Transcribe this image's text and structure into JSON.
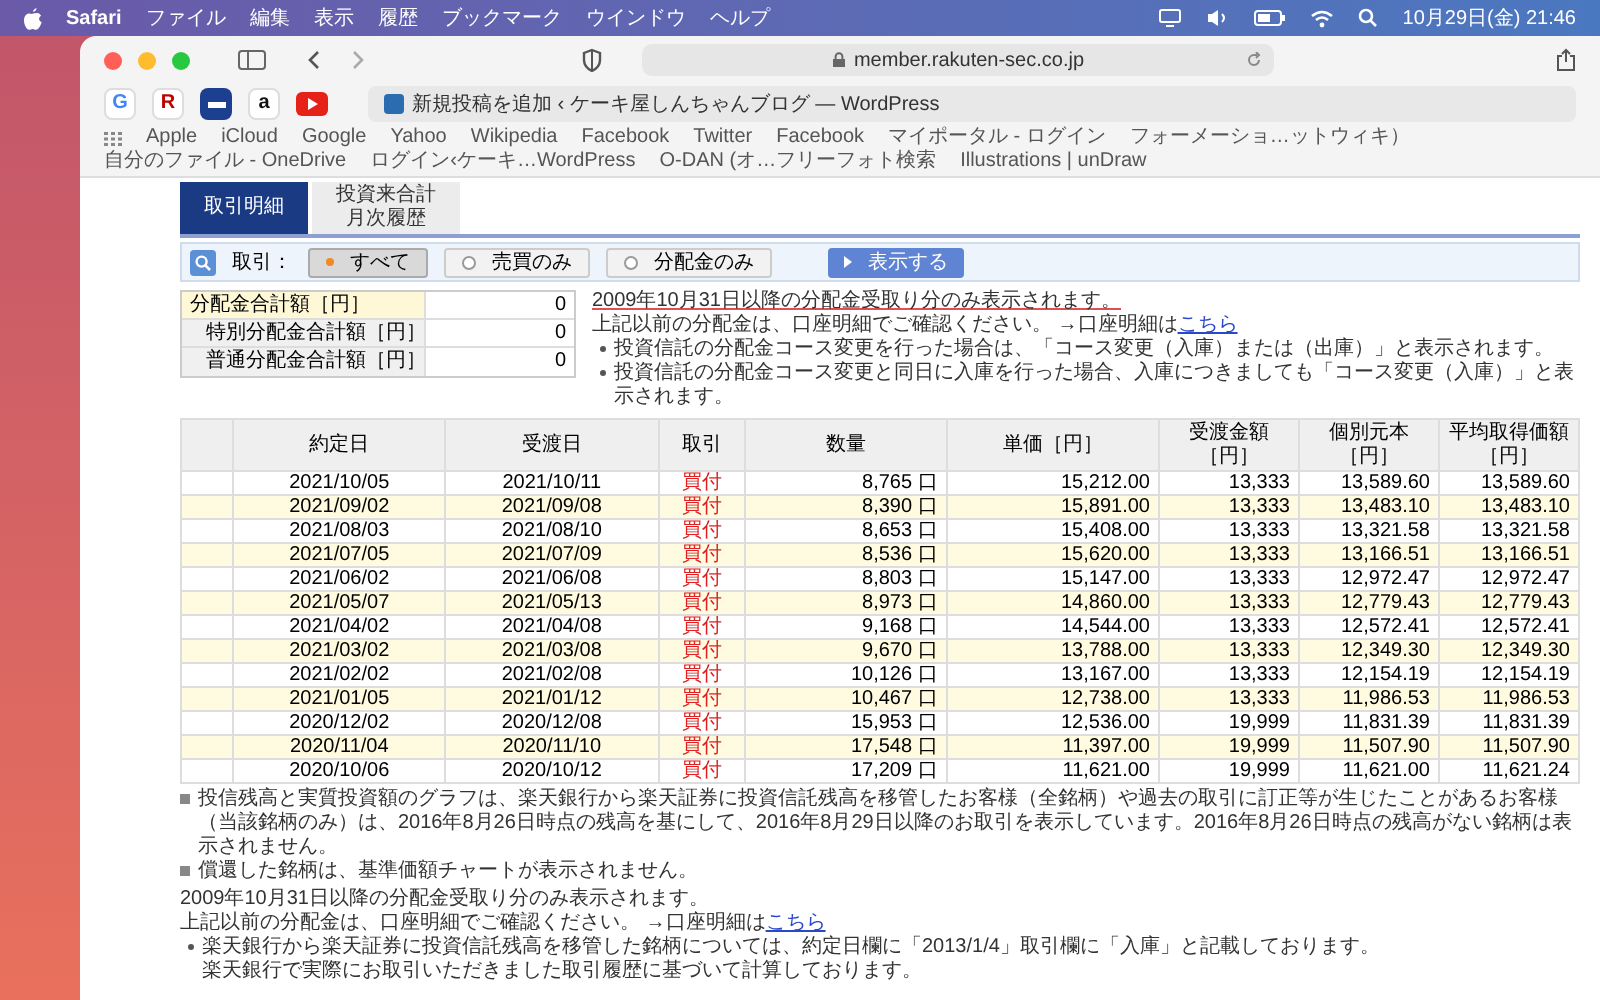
{
  "menubar": {
    "app": "Safari",
    "items": [
      "ファイル",
      "編集",
      "表示",
      "履歴",
      "ブックマーク",
      "ウインドウ",
      "ヘルプ"
    ],
    "clock": "10月29日(金) 21:46"
  },
  "browser": {
    "url": "member.rakuten-sec.co.jp",
    "favorites": [
      {
        "kind": "letter",
        "glyph": "G",
        "color": "#4285f4"
      },
      {
        "kind": "letter",
        "glyph": "R",
        "color": "#bf0000"
      },
      {
        "kind": "tile",
        "color": "#1d3f8f"
      },
      {
        "kind": "letter",
        "glyph": "a",
        "color": "#111111"
      },
      {
        "kind": "play",
        "color": "#e62117"
      }
    ],
    "tab_title": "新規投稿を追加 ‹ ケーキ屋しんちゃんブログ — WordPress",
    "bookmarks": [
      "Apple",
      "iCloud",
      "Google",
      "Yahoo",
      "Wikipedia",
      "Facebook",
      "Twitter",
      "Facebook",
      "マイポータル - ログイン",
      "フォーメーショ…ットウィキ）",
      "自分のファイル - OneDrive",
      "ログイン‹ケーキ…WordPress",
      "O-DAN (オ…フリーフォト検索",
      "Illustrations | unDraw"
    ]
  },
  "page_tabs": [
    {
      "lines": [
        "取引明細"
      ],
      "selected": true
    },
    {
      "lines": [
        "投資来合計",
        "月次履歴"
      ],
      "selected": false
    }
  ],
  "filter": {
    "label": "取引：",
    "options": [
      {
        "label": "すべて",
        "selected": true
      },
      {
        "label": "売買のみ",
        "selected": false
      },
      {
        "label": "分配金のみ",
        "selected": false
      }
    ],
    "button": "表示する"
  },
  "summary": [
    {
      "label": "分配金合計額［円］",
      "value": "0",
      "highlighted": true
    },
    {
      "label": "特別分配金合計額［円］",
      "value": "0",
      "highlighted": false
    },
    {
      "label": "普通分配金合計額［円］",
      "value": "0",
      "highlighted": false
    }
  ],
  "summary_notes": {
    "headline": "2009年10月31日以降の分配金受取り分のみ表示されます。",
    "line": "上記以前の分配金は、口座明細でご確認ください。 →口座明細は",
    "link": "こちら",
    "bullets": [
      "投資信託の分配金コース変更を行った場合は、「コース変更（入庫）または（出庫）」と表示されます。",
      "投資信託の分配金コース変更と同日に入庫を行った場合、入庫につきましても「コース変更（入庫）」と表示されます。"
    ]
  },
  "table": {
    "columns": [
      "約定日",
      "受渡日",
      "取引",
      "数量",
      "単価［円］",
      "受渡金額［円］",
      "個別元本［円］",
      "平均取得価額［円］"
    ],
    "rows": [
      [
        "2021/10/05",
        "2021/10/11",
        "買付",
        "8,765 口",
        "15,212.00",
        "13,333",
        "13,589.60",
        "13,589.60"
      ],
      [
        "2021/09/02",
        "2021/09/08",
        "買付",
        "8,390 口",
        "15,891.00",
        "13,333",
        "13,483.10",
        "13,483.10"
      ],
      [
        "2021/08/03",
        "2021/08/10",
        "買付",
        "8,653 口",
        "15,408.00",
        "13,333",
        "13,321.58",
        "13,321.58"
      ],
      [
        "2021/07/05",
        "2021/07/09",
        "買付",
        "8,536 口",
        "15,620.00",
        "13,333",
        "13,166.51",
        "13,166.51"
      ],
      [
        "2021/06/02",
        "2021/06/08",
        "買付",
        "8,803 口",
        "15,147.00",
        "13,333",
        "12,972.47",
        "12,972.47"
      ],
      [
        "2021/05/07",
        "2021/05/13",
        "買付",
        "8,973 口",
        "14,860.00",
        "13,333",
        "12,779.43",
        "12,779.43"
      ],
      [
        "2021/04/02",
        "2021/04/08",
        "買付",
        "9,168 口",
        "14,544.00",
        "13,333",
        "12,572.41",
        "12,572.41"
      ],
      [
        "2021/03/02",
        "2021/03/08",
        "買付",
        "9,670 口",
        "13,788.00",
        "13,333",
        "12,349.30",
        "12,349.30"
      ],
      [
        "2021/02/02",
        "2021/02/08",
        "買付",
        "10,126 口",
        "13,167.00",
        "13,333",
        "12,154.19",
        "12,154.19"
      ],
      [
        "2021/01/05",
        "2021/01/12",
        "買付",
        "10,467 口",
        "12,738.00",
        "13,333",
        "11,986.53",
        "11,986.53"
      ],
      [
        "2020/12/02",
        "2020/12/08",
        "買付",
        "15,953 口",
        "12,536.00",
        "19,999",
        "11,831.39",
        "11,831.39"
      ],
      [
        "2020/11/04",
        "2020/11/10",
        "買付",
        "17,548 口",
        "11,397.00",
        "19,999",
        "11,507.90",
        "11,507.90"
      ],
      [
        "2020/10/06",
        "2020/10/12",
        "買付",
        "17,209 口",
        "11,621.00",
        "19,999",
        "11,621.00",
        "11,621.24"
      ]
    ]
  },
  "footnotes": [
    "投信残高と実質投資額のグラフは、楽天銀行から楽天証券に投資信託残高を移管したお客様（全銘柄）や過去の取引に訂正等が生じたことがあるお客様（当該銘柄のみ）は、2016年8月26日時点の残高を基にして、2016年8月29日以降のお取引を表示しています。2016年8月26日時点の残高がない銘柄は表示されません。",
    "償還した銘柄は、基準価額チャートが表示されません。"
  ],
  "bottom_notes": {
    "headline": "2009年10月31日以降の分配金受取り分のみ表示されます。",
    "line": "上記以前の分配金は、口座明細でご確認ください。 →口座明細は",
    "link": "こちら",
    "bullets": [
      [
        "楽天銀行から楽天証券に投資信託残高を移管した銘柄については、約定日欄に「2013/1/4」取引欄に「入庫」と記載しております。",
        "楽天銀行で実際にお取引いただきました取引履歴に基づいて計算しております。"
      ]
    ]
  }
}
